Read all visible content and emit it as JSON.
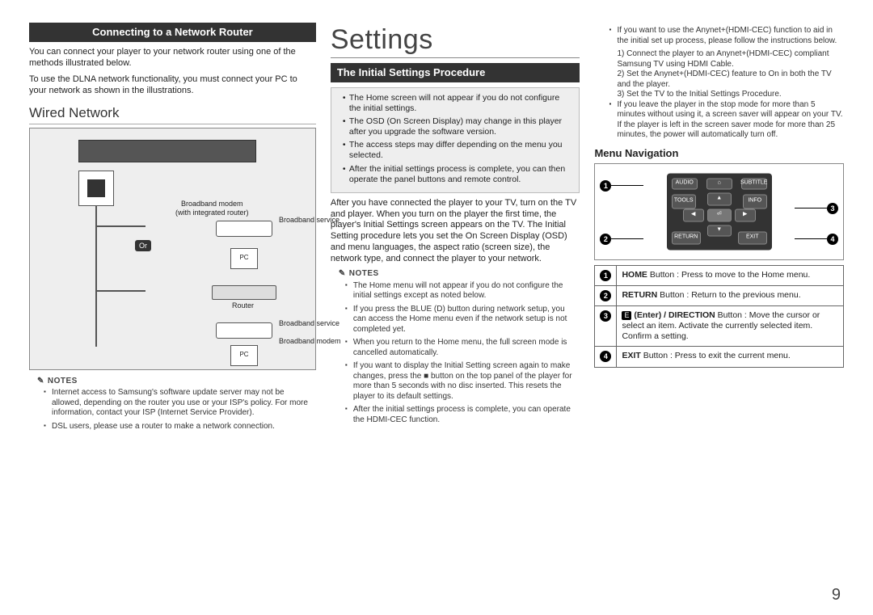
{
  "left": {
    "bar": "Connecting to a Network Router",
    "intro1": "You can connect your player to your network router using one of the methods illustrated below.",
    "intro2": "To use the DLNA network functionality, you must connect your PC to your network as shown in the illustrations.",
    "wired": "Wired Network",
    "diagram": {
      "bm_router": "Broadband modem\n(with integrated router)",
      "bservice1": "Broadband service",
      "or": "Or",
      "pc1": "PC",
      "router": "Router",
      "bservice2": "Broadband service",
      "bmodem": "Broadband modem",
      "pc2": "PC"
    },
    "notes_hd": "NOTES",
    "notes": [
      "Internet access to Samsung's software update server may not be allowed, depending on the router you use or your ISP's policy. For more information, contact your ISP (Internet Service Provider).",
      "DSL users, please use a router to make a network connection."
    ]
  },
  "mid": {
    "title": "Settings",
    "bar": "The Initial Settings Procedure",
    "grey": [
      "The Home screen will not appear if you do not configure the initial settings.",
      "The OSD (On Screen Display) may change in this player after you upgrade the software version.",
      "The access steps may differ depending on the menu you selected.",
      "After the initial settings process is complete, you can then operate the panel buttons and remote control."
    ],
    "body": "After you have connected the player to your TV, turn on the TV and player. When you turn on the player the first time, the player's Initial Settings screen appears on the TV. The Initial Setting procedure lets you set the On Screen Display (OSD) and menu languages, the aspect ratio (screen size), the network type, and connect the player to your network.",
    "notes_hd": "NOTES",
    "notes": [
      "The Home menu will not appear if you do not configure the initial settings except as noted below.",
      "If you press the BLUE (D) button during network setup, you can access the Home menu even if the network setup is not completed yet.",
      "When you return to the Home menu, the full screen mode is cancelled automatically.",
      "If you want to display the Initial Setting screen again to make changes, press the ■ button on the top panel of the player for more than 5 seconds with no disc inserted. This resets the player to its default settings.",
      "After the initial settings process is complete, you can operate the HDMI-CEC function."
    ]
  },
  "right": {
    "pre_notes": [
      "If you want to use the Anynet+(HDMI-CEC) function to aid in the initial set up process, please follow the instructions below.",
      "1) Connect the player to an Anynet+(HDMI-CEC) compliant Samsung TV using HDMI Cable.",
      "2) Set the Anynet+(HDMI-CEC) feature to On in both the TV and the player.",
      "3) Set the TV to the Initial Settings Procedure.",
      "If you leave the player in the stop mode for more than 5 minutes without using it, a screen saver will appear on your TV. If the player is left in the screen saver mode for more than 25 minutes, the power will automatically turn off."
    ],
    "menu_nav": "Menu Navigation",
    "table": [
      {
        "n": "1",
        "t": "HOME Button : Press to move to the Home menu."
      },
      {
        "n": "2",
        "t": "RETURN Button : Return to the previous menu."
      },
      {
        "n": "3",
        "t": "E (Enter) / DIRECTION Button : Move the cursor or select an item. Activate the currently selected item. Confirm a setting."
      },
      {
        "n": "4",
        "t": "EXIT Button : Press to exit the current menu."
      }
    ]
  },
  "pagenum": "9"
}
